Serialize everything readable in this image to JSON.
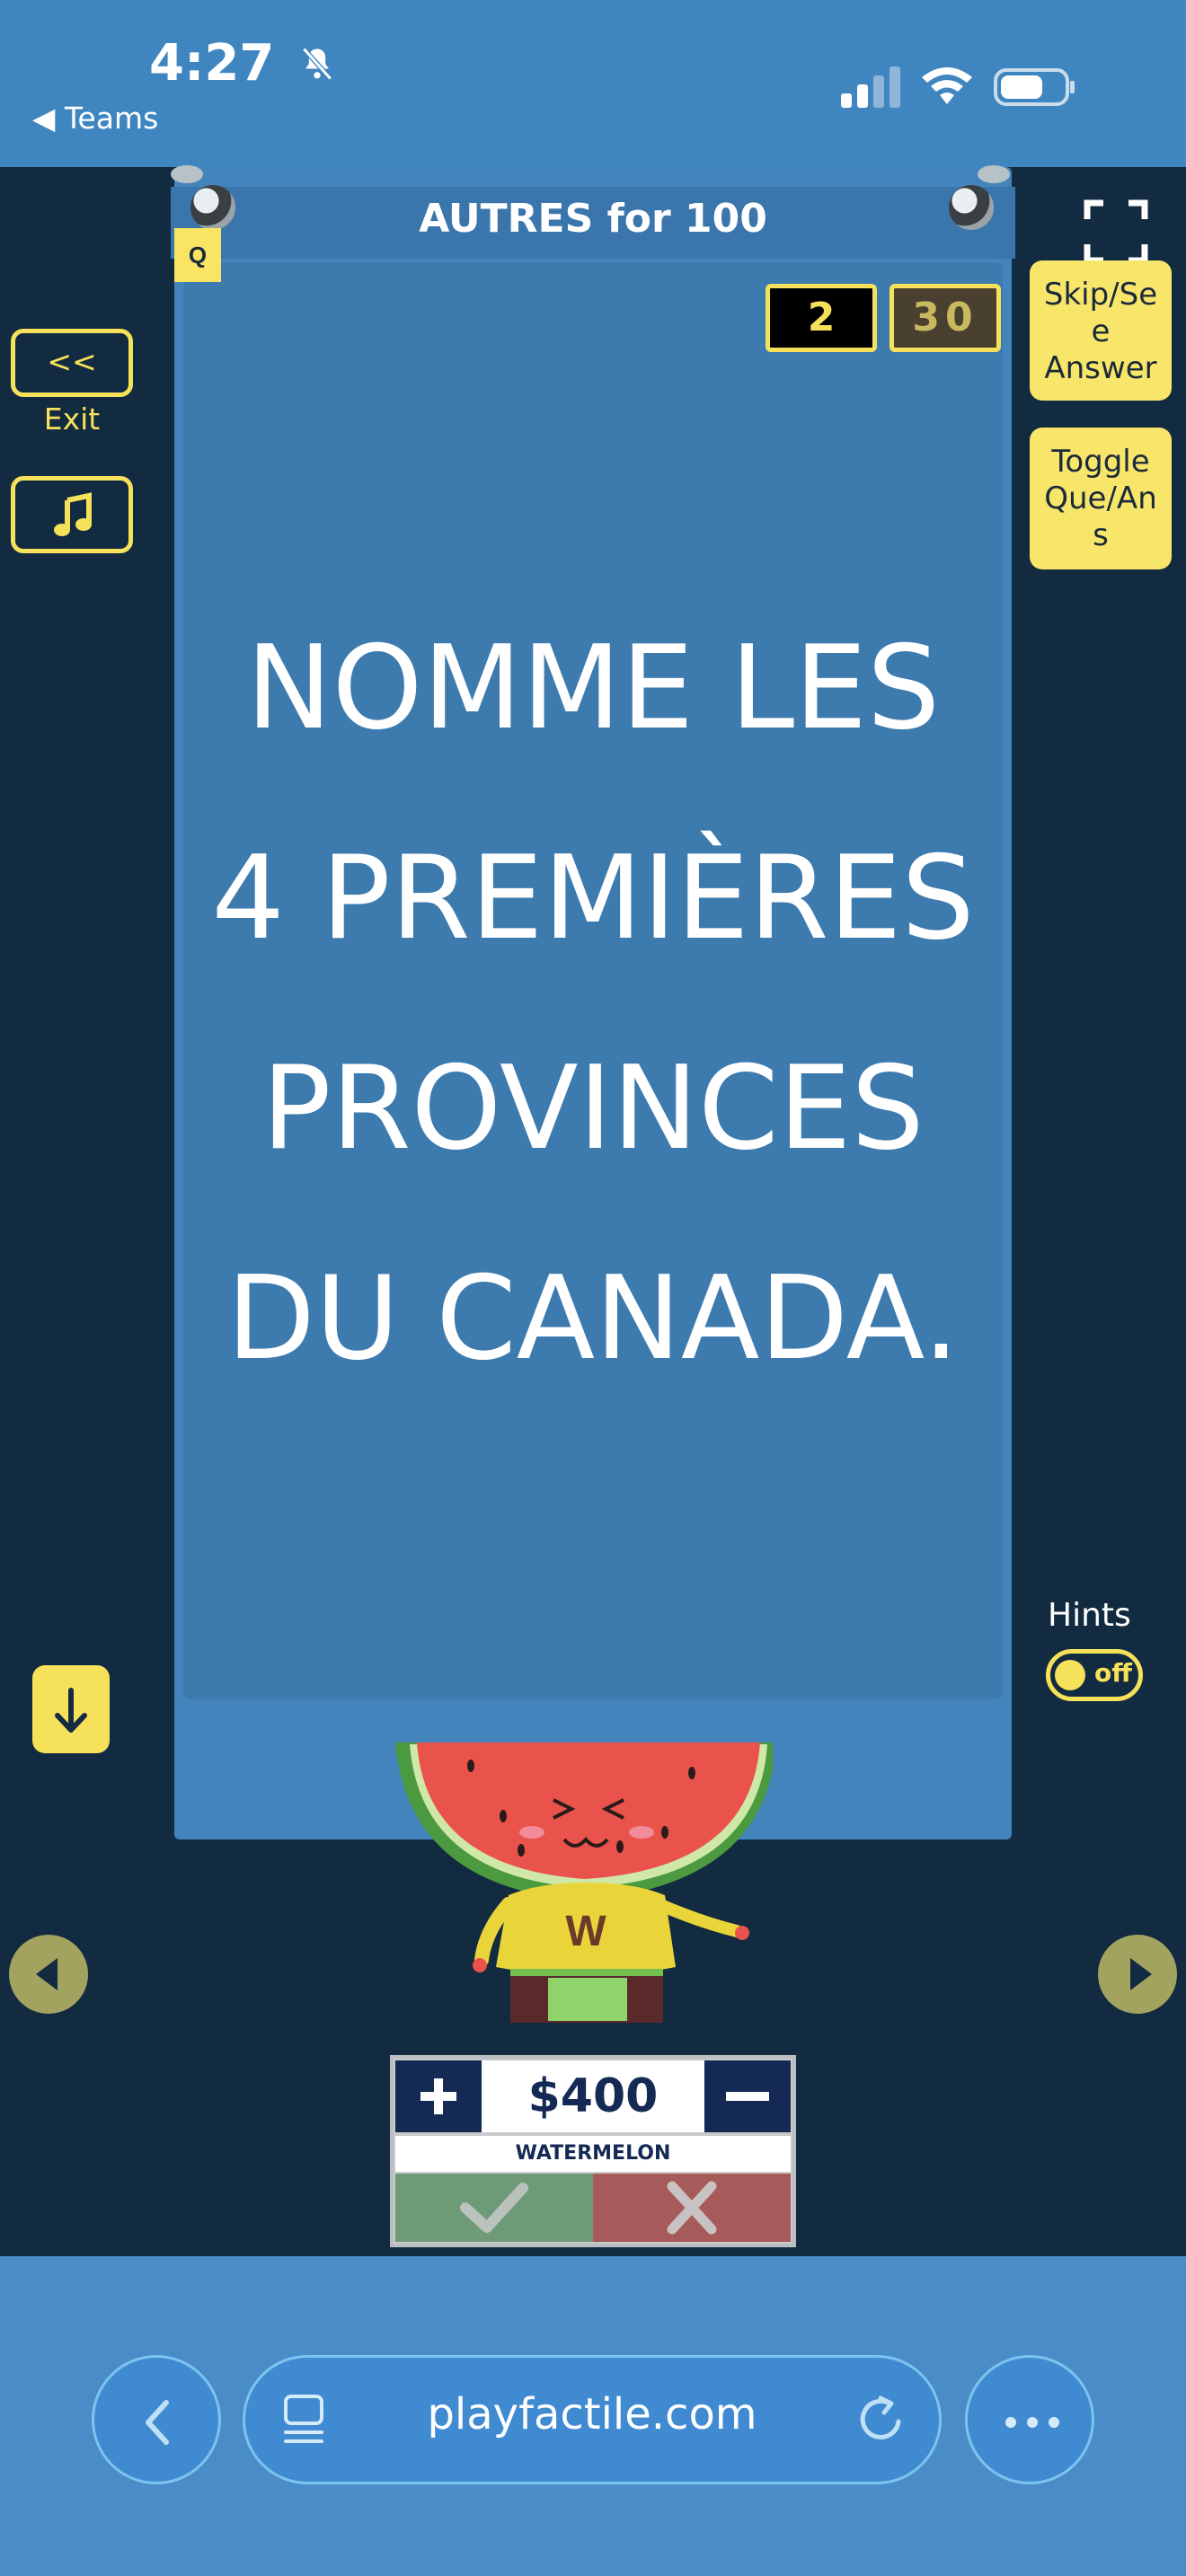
{
  "status_bar": {
    "time": "4:27",
    "back_app": "◀ Teams"
  },
  "card": {
    "title": "AUTRES for 100",
    "badge": "Q",
    "score_display": "2",
    "timer_display": "30",
    "question_lines": [
      "NOMME LES",
      "4 PREMIÈRES",
      "PROVINCES",
      "DU CANADA."
    ]
  },
  "left_controls": {
    "exit_label": "<< Exit",
    "music_icon": "music-note-icon",
    "down_icon": "arrow-down-icon",
    "prev_icon": "triangle-left-icon"
  },
  "right_controls": {
    "skip_lines": [
      "Skip/Se",
      "e",
      "Answer"
    ],
    "toggle_lines": [
      "Toggle",
      "Que/An",
      "s"
    ],
    "hints_label": "Hints",
    "hints_state": "off",
    "next_icon": "triangle-right-icon"
  },
  "team": {
    "score": "$400",
    "name": "WATERMELON",
    "mascot_letter": "W"
  },
  "browser": {
    "url": "playfactile.com"
  },
  "colors": {
    "accent_yellow": "#f6e15a",
    "card_blue": "#4484bd",
    "background_dark": "#132b40"
  }
}
